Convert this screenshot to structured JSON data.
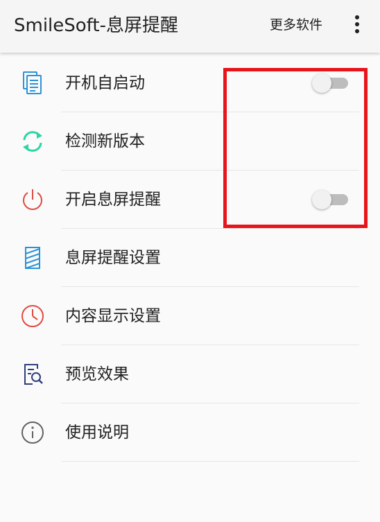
{
  "appbar": {
    "title": "SmileSoft-息屏提醒",
    "more_software": "更多软件",
    "overflow_icon": "more-vert-icon"
  },
  "settings": [
    {
      "label": "开机自启动",
      "icon": "document-list-icon",
      "icon_color": "#2a93d5",
      "has_switch": true,
      "switch_on": false
    },
    {
      "label": "检测新版本",
      "icon": "sync-icon",
      "icon_color": "#2bd6a5",
      "has_switch": false
    },
    {
      "label": "开启息屏提醒",
      "icon": "power-icon",
      "icon_color": "#e04a3f",
      "has_switch": true,
      "switch_on": false
    },
    {
      "label": "息屏提醒设置",
      "icon": "striped-panel-icon",
      "icon_color": "#2a93d5",
      "has_switch": false
    },
    {
      "label": "内容显示设置",
      "icon": "clock-icon",
      "icon_color": "#e04a3f",
      "has_switch": false
    },
    {
      "label": "预览效果",
      "icon": "document-search-icon",
      "icon_color": "#2f3d7a",
      "has_switch": false
    },
    {
      "label": "使用说明",
      "icon": "info-icon",
      "icon_color": "#616161",
      "has_switch": false
    }
  ],
  "colors": {
    "annotation_box": "#e8141b",
    "switch_track_off": "#bdbdbd",
    "switch_thumb_off": "#f1f1f1"
  }
}
